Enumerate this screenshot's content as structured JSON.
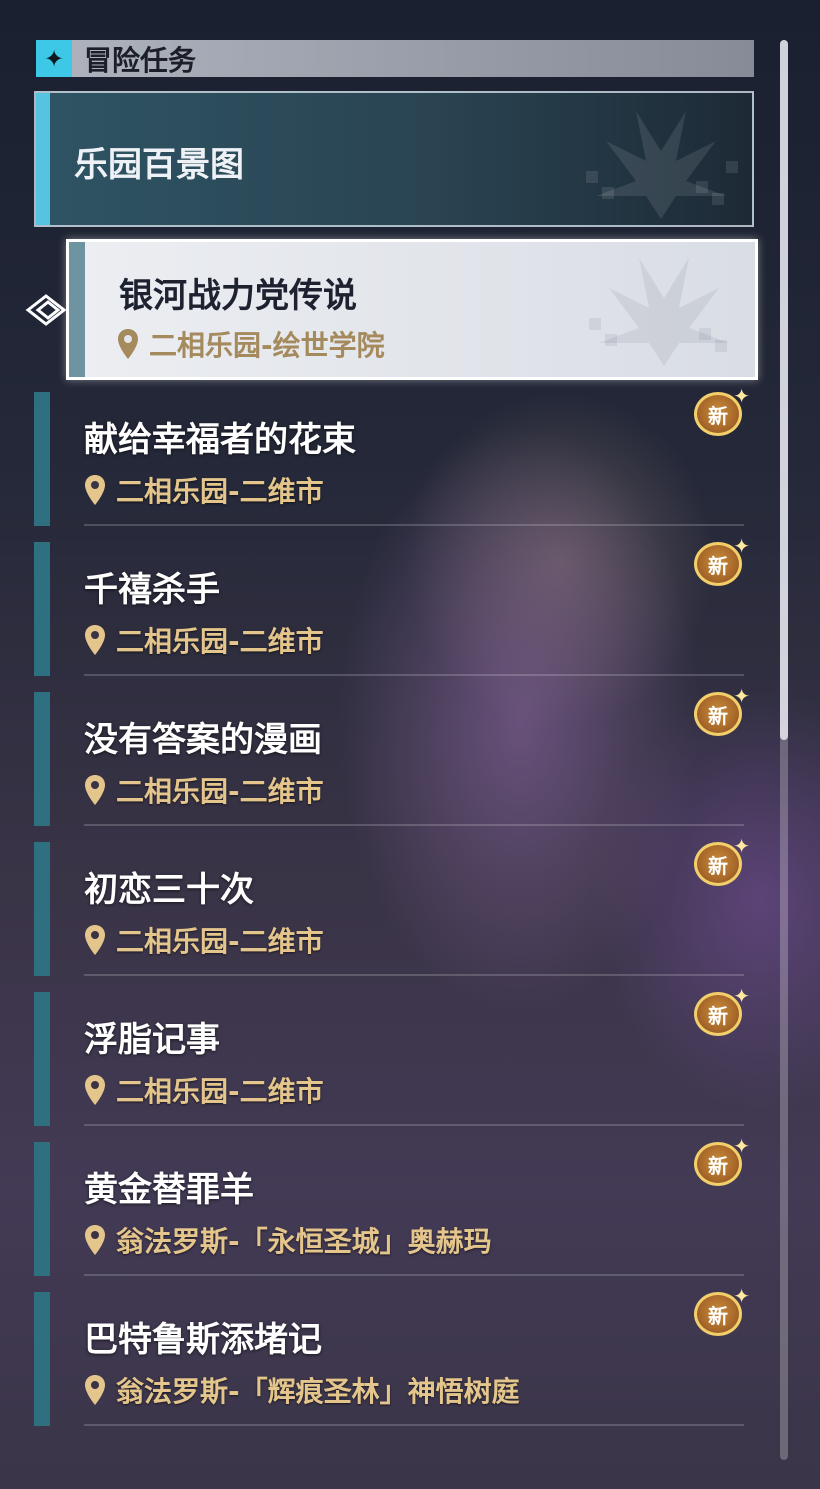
{
  "header": {
    "icon": "sparkle-icon",
    "title": "冒险任务"
  },
  "category": {
    "label": "乐园百景图"
  },
  "selected_quest": {
    "title": "银河战力党传说",
    "location": "二相乐园-绘世学院"
  },
  "new_badge_label": "新",
  "quests": [
    {
      "title": "献给幸福者的花束",
      "location": "二相乐园-二维市",
      "is_new": true
    },
    {
      "title": "千禧杀手",
      "location": "二相乐园-二维市",
      "is_new": true
    },
    {
      "title": "没有答案的漫画",
      "location": "二相乐园-二维市",
      "is_new": true
    },
    {
      "title": "初恋三十次",
      "location": "二相乐园-二维市",
      "is_new": true
    },
    {
      "title": "浮脂记事",
      "location": "二相乐园-二维市",
      "is_new": true
    },
    {
      "title": "黄金替罪羊",
      "location": "翁法罗斯-「永恒圣城」奥赫玛",
      "is_new": true
    },
    {
      "title": "巴特鲁斯添堵记",
      "location": "翁法罗斯-「辉痕圣林」神悟树庭",
      "is_new": true
    }
  ],
  "colors": {
    "accent_cyan": "#56c4e0",
    "quest_bar": "#2e6f80",
    "location_text": "#e4c58c",
    "new_badge_gold": "#c88d3a"
  }
}
